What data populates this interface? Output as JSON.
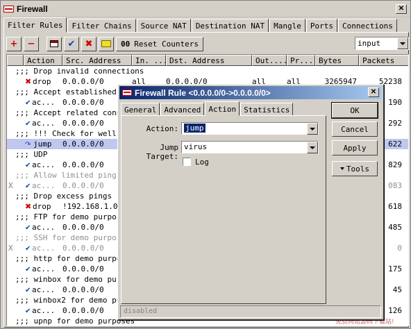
{
  "window": {
    "title": "Firewall"
  },
  "tabs": [
    "Filter Rules",
    "Filter Chains",
    "Source NAT",
    "Destination NAT",
    "Mangle",
    "Ports",
    "Connections"
  ],
  "toolbar": {
    "reset_label": "Reset Counters",
    "reset_prefix": "00",
    "chain_filter": "input"
  },
  "columns": [
    "Action",
    "Src. Address",
    "In. ...",
    "Dst. Address",
    "Out....",
    "Pr...",
    "Bytes",
    "Packets"
  ],
  "rows": [
    {
      "flag": "",
      "type": "comment",
      "text": ";;; Drop invalid connections"
    },
    {
      "flag": "",
      "type": "rule",
      "icon": "drop",
      "action": "drop",
      "src": "0.0.0.0/0",
      "in": "all",
      "dst": "0.0.0.0/0",
      "out": "all",
      "proto": "all",
      "bytes": "3265947",
      "packets": "52238"
    },
    {
      "flag": "",
      "type": "comment",
      "text": ";;; Accept established c"
    },
    {
      "flag": "",
      "type": "rule",
      "icon": "accept",
      "action": "ac...",
      "src": "0.0.0.0/0",
      "packets": "190"
    },
    {
      "flag": "",
      "type": "comment",
      "text": ";;; Accept related conne"
    },
    {
      "flag": "",
      "type": "rule",
      "icon": "accept",
      "action": "ac...",
      "src": "0.0.0.0/0",
      "packets": "292"
    },
    {
      "flag": "",
      "type": "comment",
      "text": ";;; !!! Check for well-k"
    },
    {
      "flag": "",
      "type": "rule",
      "icon": "jump",
      "action": "jump",
      "src": "0.0.0.0/0",
      "packets": "622",
      "selected": true
    },
    {
      "flag": "",
      "type": "comment",
      "text": ";;; UDP"
    },
    {
      "flag": "",
      "type": "rule",
      "icon": "accept",
      "action": "ac...",
      "src": "0.0.0.0/0",
      "packets": "829"
    },
    {
      "flag": "",
      "type": "comment",
      "text": ";;; Allow limited pings",
      "disabled": true
    },
    {
      "flag": "X",
      "type": "rule",
      "icon": "accept",
      "action": "ac...",
      "src": "0.0.0.0/0",
      "packets": "083",
      "disabled": true
    },
    {
      "flag": "",
      "type": "comment",
      "text": ";;; Drop excess pings"
    },
    {
      "flag": "",
      "type": "rule",
      "icon": "drop",
      "action": "drop",
      "src": "!192.168.1.0/",
      "packets": "618"
    },
    {
      "flag": "",
      "type": "comment",
      "text": ";;; FTP for demo purpose"
    },
    {
      "flag": "",
      "type": "rule",
      "icon": "accept",
      "action": "ac...",
      "src": "0.0.0.0/0",
      "packets": "485"
    },
    {
      "flag": "",
      "type": "comment",
      "text": ";;; SSH for demo purpose",
      "disabled": true
    },
    {
      "flag": "X",
      "type": "rule",
      "icon": "accept",
      "action": "ac...",
      "src": "0.0.0.0/0",
      "packets": "0",
      "disabled": true
    },
    {
      "flag": "",
      "type": "comment",
      "text": ";;; http for demo purpos"
    },
    {
      "flag": "",
      "type": "rule",
      "icon": "accept",
      "action": "ac...",
      "src": "0.0.0.0/0",
      "packets": "175"
    },
    {
      "flag": "",
      "type": "comment",
      "text": ";;; winbox for demo purp"
    },
    {
      "flag": "",
      "type": "rule",
      "icon": "accept",
      "action": "ac...",
      "src": "0.0.0.0/0",
      "packets": "45"
    },
    {
      "flag": "",
      "type": "comment",
      "text": ";;; winbox2 for demo pur"
    },
    {
      "flag": "",
      "type": "rule",
      "icon": "accept",
      "action": "ac...",
      "src": "0.0.0.0/0",
      "packets": "126"
    },
    {
      "flag": "",
      "type": "comment",
      "text": ";;; upnp for demo purposes"
    }
  ],
  "dialog": {
    "title": "Firewall Rule <0.0.0.0/0->0.0.0.0/0>",
    "tabs": [
      "General",
      "Advanced",
      "Action",
      "Statistics"
    ],
    "action_label": "Action:",
    "action_value": "jump",
    "jump_target_label": "Jump Target:",
    "jump_target_value": "virus",
    "log_label": "Log",
    "buttons": {
      "ok": "OK",
      "cancel": "Cancel",
      "apply": "Apply",
      "tools": "Tools"
    },
    "status": "disabled"
  },
  "watermark": {
    "main": "asp",
    "accent": "ku",
    "suffix": ".com",
    "sub": "免费网站源码下载站!"
  }
}
